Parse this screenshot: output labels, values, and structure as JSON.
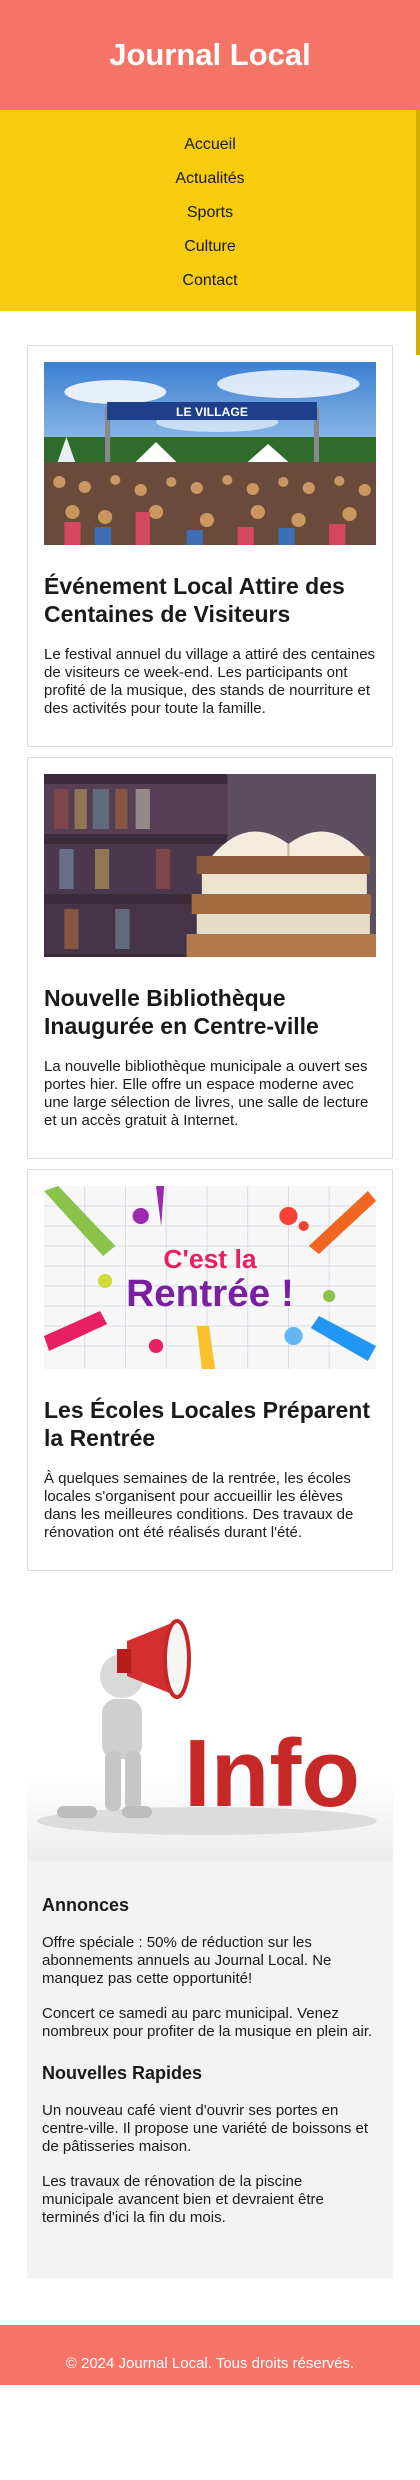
{
  "header": {
    "title": "Journal Local"
  },
  "nav": {
    "items": [
      "Accueil",
      "Actualités",
      "Sports",
      "Culture",
      "Contact"
    ]
  },
  "articles": [
    {
      "banner_text": "LE VILLAGE",
      "title": "Événement Local Attire des Centaines de Visiteurs",
      "body": "Le festival annuel du village a attiré des centaines de visiteurs ce week-end. Les participants ont profité de la musique, des stands de nourriture et des activités pour toute la famille."
    },
    {
      "title": "Nouvelle Bibliothèque Inaugurée en Centre-ville",
      "body": "La nouvelle bibliothèque municipale a ouvert ses portes hier. Elle offre un espace moderne avec une large sélection de livres, une salle de lecture et un accès gratuit à Internet."
    },
    {
      "image_text_top": "C'est la",
      "image_text_bottom": "Rentrée !",
      "title": "Les Écoles Locales Préparent la Rentrée",
      "body": "À quelques semaines de la rentrée, les écoles locales s'organisent pour accueillir les élèves dans les meilleures conditions. Des travaux de rénovation ont été réalisés durant l'été."
    }
  ],
  "info_image": {
    "word": "Info"
  },
  "sidebar": {
    "announcements_title": "Annonces",
    "announcements": [
      "Offre spéciale : 50% de réduction sur les abonnements annuels au Journal Local. Ne manquez pas cette opportunité!",
      "Concert ce samedi au parc municipal. Venez nombreux pour profiter de la musique en plein air."
    ],
    "news_title": "Nouvelles Rapides",
    "news": [
      "Un nouveau café vient d'ouvrir ses portes en centre-ville. Il propose une variété de boissons et de pâtisseries maison.",
      "Les travaux de rénovation de la piscine municipale avancent bien et devraient être terminés d'ici la fin du mois."
    ]
  },
  "footer": {
    "text": "© 2024 Journal Local. Tous droits réservés."
  },
  "colors": {
    "header": "#f47568",
    "nav": "#f7cc0e",
    "sidebar": "#f2f2f2"
  }
}
